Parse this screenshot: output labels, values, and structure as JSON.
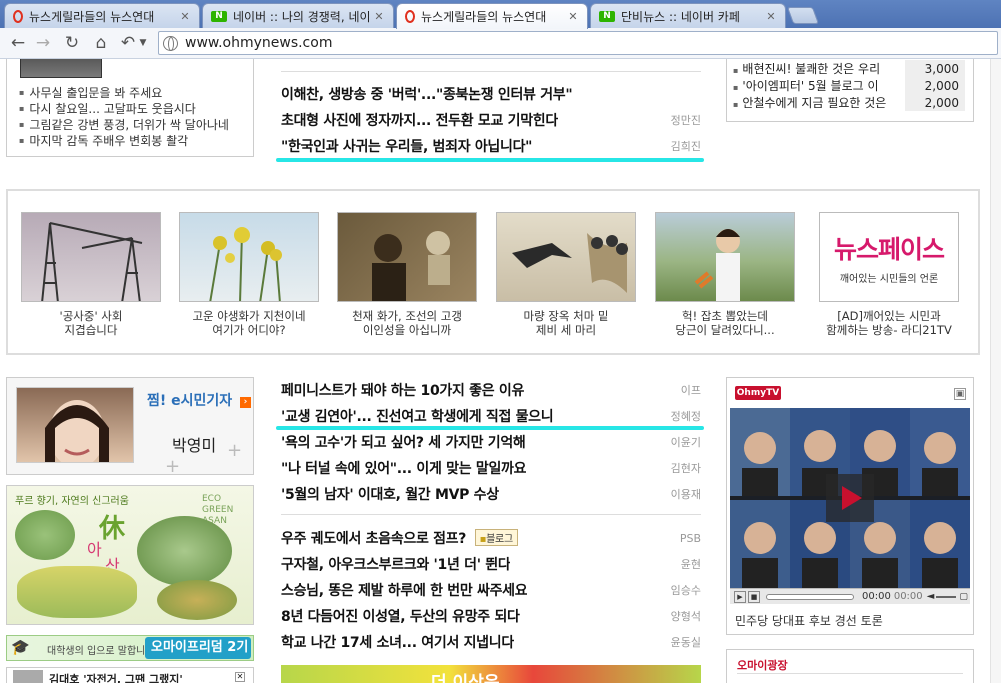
{
  "browser": {
    "tabs": [
      {
        "title": "뉴스게릴라들의 뉴스연대",
        "icon": "ohmynews-favicon",
        "active": false
      },
      {
        "title": "네이버 :: 나의 경쟁력, 네이",
        "icon": "naver-favicon",
        "active": false
      },
      {
        "title": "뉴스게릴라들의 뉴스연대",
        "icon": "ohmynews-favicon",
        "active": true
      },
      {
        "title": "단비뉴스 :: 네이버 카페",
        "icon": "naver-favicon",
        "active": false
      }
    ],
    "url": "www.ohmynews.com",
    "naver_fav_text": "N"
  },
  "left_top": {
    "items": [
      "사무실 출입문을 봐 주세요",
      "다시 찰요일... 고달파도 웃읍시다",
      "그림같은 강변 풍경, 더위가 싹 달아나네",
      "마지막 감독 주배우 변회봉 촬각"
    ]
  },
  "center_top": {
    "rows": [
      {
        "headline": "이해찬, 생방송 중 '버럭'...\"종북논쟁 인터뷰 거부\"",
        "byline": ""
      },
      {
        "headline": "초대형 사진에 정자까지... 전두환 모교 기막힌다",
        "byline": "정만진"
      },
      {
        "headline": "\"한국인과 사귀는 우리들, 범죄자 아닙니다\"",
        "byline": "김희진"
      }
    ]
  },
  "right_top": {
    "ranking": [
      {
        "title": "배현진씨! 불쾌한 것은 우리",
        "value": "3,000"
      },
      {
        "title": "'아이엠피터' 5월 블로그 이",
        "value": "2,000"
      },
      {
        "title": "안철수에게 지금 필요한 것은",
        "value": "2,000"
      }
    ]
  },
  "photo_strip": [
    {
      "caption_1": "'공사중' 사회",
      "caption_2": "지겹습니다"
    },
    {
      "caption_1": "고운 야생화가 지천이네",
      "caption_2": "여기가 어디야?"
    },
    {
      "caption_1": "천재 화가, 조선의 고갱",
      "caption_2": "이인성을 아십니까"
    },
    {
      "caption_1": "마량 장옥 처마 밑",
      "caption_2": "제비 세 마리"
    },
    {
      "caption_1": "헉! 잡초 뽑았는데",
      "caption_2": "당근이 달려있다니..."
    },
    {
      "caption_1": "[AD]깨어있는 시민과",
      "caption_2": "함께하는 방송- 라디21TV",
      "logo_text": "뉴스페이스",
      "logo_sub": "깨어있는 시민들의 언론"
    }
  ],
  "citizen": {
    "title": "찜! e시민기자",
    "name": "박영미"
  },
  "ad_banner": {
    "line_1": "푸르 향기, 자연의 신그러움",
    "big_1": "休",
    "big_2": "아",
    "big_3": "산",
    "green": "ECO GREEN ASAN"
  },
  "school_banner": {
    "text": "대학생의 입으로 말합니다",
    "brand": "오마이프리덤 2기"
  },
  "left_bottom": {
    "item": "김대호 '자전거, 그땐 그랬지'"
  },
  "center_bottom": {
    "group_1": [
      {
        "headline": "페미니스트가 돼야 하는 10가지 좋은 이유",
        "byline": "이프"
      },
      {
        "headline": "'교생 김연아'... 진선여고 학생에게 직접 물으니",
        "byline": "정혜정"
      },
      {
        "headline": "'욕의 고수'가 되고 싶어? 세 가지만 기억해",
        "byline": "이윤기"
      },
      {
        "headline": "\"나 터널 속에 있어\"... 이게 맞는 말일까요",
        "byline": "김현자"
      },
      {
        "headline": "'5월의 남자' 이대호, 월간 MVP 수상",
        "byline": "이용재"
      }
    ],
    "group_2": [
      {
        "headline": "우주 궤도에서 초음속으로 점프?",
        "byline": "PSB",
        "tag": "블로그"
      },
      {
        "headline": "구자철, 아우크스부르크와 '1년 더' 뛴다",
        "byline": "윤현"
      },
      {
        "headline": "스승님, 똥은 제발 하루에 한 번만 싸주세요",
        "byline": "임승수"
      },
      {
        "headline": "8년 다듬어진 이성열, 두산의 유망주 되다",
        "byline": "양형석"
      },
      {
        "headline": "학교 나간 17세 소녀... 여기서 지냅니다",
        "byline": "윤동실"
      }
    ],
    "banner_text": "더 이상은"
  },
  "ohmytv": {
    "logo": "OhmyTV",
    "time": "00:00",
    "duration": "00:00",
    "caption": "민주당 당대표 후보 경선 토론"
  },
  "ohmy_square": {
    "title": "오마이광장"
  }
}
